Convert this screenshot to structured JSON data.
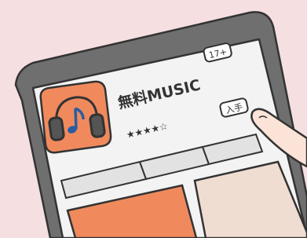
{
  "app": {
    "name": "無料MUSIC",
    "rating_stars": "★★★★☆",
    "age_rating": "17+",
    "get_button_label": "入手"
  },
  "icon": {
    "semantic": "headphones-music-note-icon",
    "background_color": "#f08a5d"
  },
  "colors": {
    "background": "#f6dfe1",
    "tablet_frame": "#6f6f6f",
    "screen": "#f3f3f3",
    "accent": "#f08a5d",
    "tile_secondary": "#f0ddd2",
    "segment": "#e2e2e2"
  }
}
